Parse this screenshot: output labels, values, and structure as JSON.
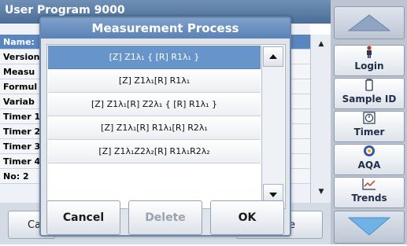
{
  "background_screen": {
    "title": "User Program  9000",
    "rows": [
      "Name:",
      "Version",
      "Measu",
      "Formul",
      "Variab",
      "Timer 1",
      "Timer 2",
      "Timer 3",
      "Timer 4",
      "No: 2"
    ],
    "bottom_left_label": "Ca",
    "bottom_right_label": "re"
  },
  "side_panel": {
    "buttons": [
      {
        "label": "Login",
        "icon": "person-icon"
      },
      {
        "label": "Sample ID",
        "icon": "bottle-icon"
      },
      {
        "label": "Timer",
        "icon": "timer-icon"
      },
      {
        "label": "AQA",
        "icon": "aqa-icon"
      },
      {
        "label": "Trends",
        "icon": "trends-chart-icon"
      }
    ]
  },
  "dialog": {
    "title": "Measurement Process",
    "options": [
      "[Z] Z1λ₁ { [R] R1λ₁ }",
      "[Z] Z1λ₁[R] R1λ₁",
      "[Z] Z1λ₁[R] Z2λ₁ { [R] R1λ₁ }",
      "[Z] Z1λ₁[R] R1λ₁[R] R2λ₁",
      "[Z] Z1λ₁Z2λ₂[R] R1λ₁R2λ₂"
    ],
    "selected_index": 0,
    "buttons": {
      "cancel": "Cancel",
      "delete": "Delete",
      "ok": "OK"
    }
  },
  "colors": {
    "selection": "#6794c9",
    "title_bar": "#5b82b6",
    "side_panel": "#bcc5d1"
  }
}
